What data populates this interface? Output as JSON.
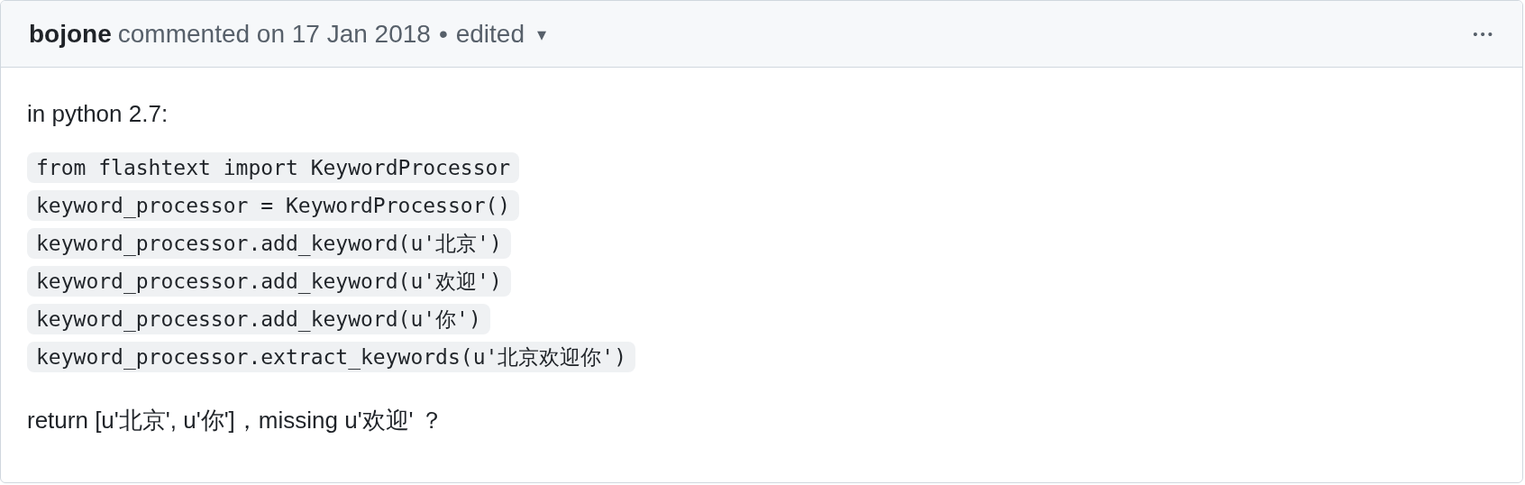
{
  "comment": {
    "author": "bojone",
    "action": "commented on 17 Jan 2018",
    "separator": "•",
    "edited_label": "edited",
    "caret": "▾",
    "menu": "•••",
    "intro": "in python 2.7:",
    "code_lines": [
      "from flashtext import KeywordProcessor",
      "keyword_processor = KeywordProcessor()",
      "keyword_processor.add_keyword(u'北京')",
      "keyword_processor.add_keyword(u'欢迎')",
      "keyword_processor.add_keyword(u'你')",
      "keyword_processor.extract_keywords(u'北京欢迎你')"
    ],
    "outro": "return [u'北京', u'你']，missing u'欢迎' ？"
  }
}
